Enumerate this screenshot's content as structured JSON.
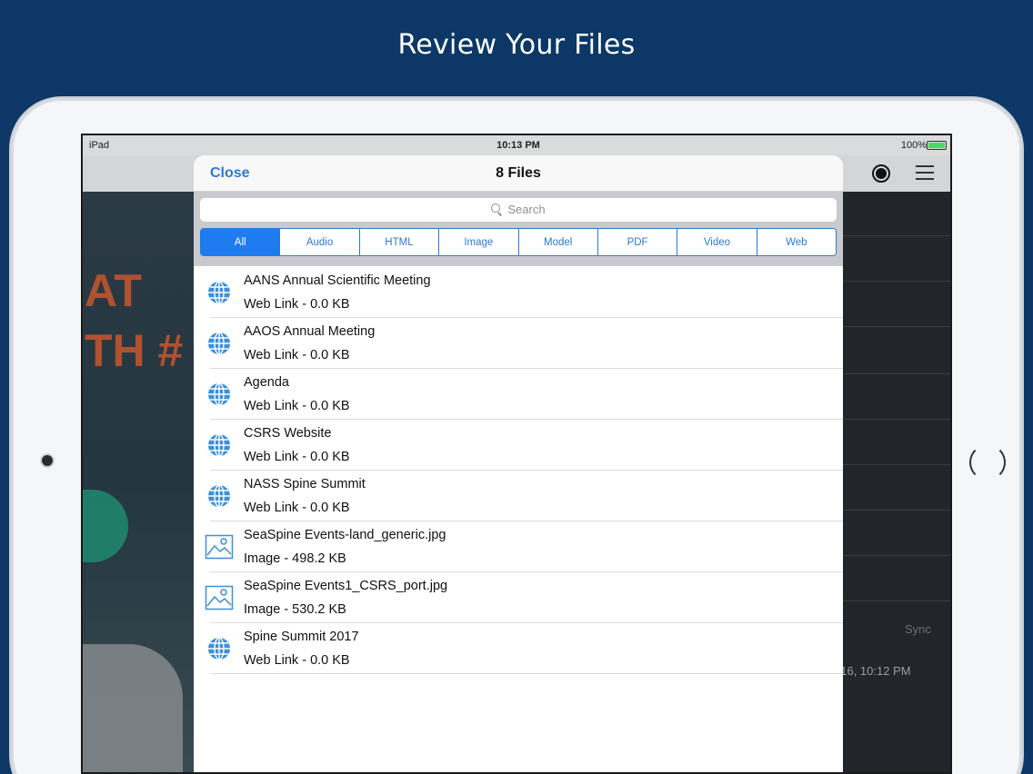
{
  "headline": "Review Your Files",
  "status_bar": {
    "device": "iPad",
    "time": "10:13 PM",
    "battery": "100%"
  },
  "background_app": {
    "text_line1": "AT",
    "text_line2": "TH #",
    "sync_label": "Sync",
    "date_fragment": "016, 10:12 PM"
  },
  "modal": {
    "close_label": "Close",
    "title": "8 Files",
    "search_placeholder": "Search",
    "segments": [
      "All",
      "Audio",
      "HTML",
      "Image",
      "Model",
      "PDF",
      "Video",
      "Web"
    ],
    "active_segment": "All",
    "files": [
      {
        "name": "AANS Annual Scientific Meeting",
        "meta": "Web Link - 0.0 KB",
        "icon": "globe-icon"
      },
      {
        "name": "AAOS Annual Meeting",
        "meta": "Web Link - 0.0 KB",
        "icon": "globe-icon"
      },
      {
        "name": "Agenda",
        "meta": "Web Link - 0.0 KB",
        "icon": "globe-icon"
      },
      {
        "name": "CSRS Website",
        "meta": "Web Link - 0.0 KB",
        "icon": "globe-icon"
      },
      {
        "name": "NASS Spine Summit",
        "meta": "Web Link - 0.0 KB",
        "icon": "globe-icon"
      },
      {
        "name": "SeaSpine Events-land_generic.jpg",
        "meta": "Image - 498.2 KB",
        "icon": "image-icon"
      },
      {
        "name": "SeaSpine Events1_CSRS_port.jpg",
        "meta": "Image - 530.2 KB",
        "icon": "image-icon"
      },
      {
        "name": "Spine Summit 2017",
        "meta": "Web Link - 0.0 KB",
        "icon": "globe-icon"
      }
    ]
  },
  "colors": {
    "page_background": "#0c3766",
    "accent": "#2a7bd4",
    "active_segment": "#1e7cf0"
  }
}
